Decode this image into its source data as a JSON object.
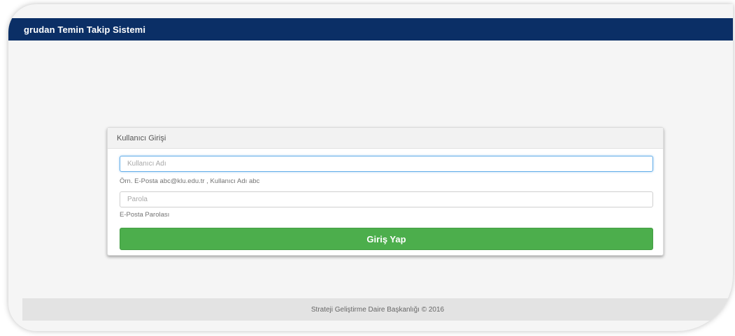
{
  "navbar": {
    "brand": "grudan Temin Takip Sistemi"
  },
  "login": {
    "heading": "Kullanıcı Girişi",
    "username_placeholder": "Kullanıcı Adı",
    "username_help": "Örn. E-Posta abc@klu.edu.tr , Kullanıcı Adı abc",
    "password_placeholder": "Parola",
    "password_help": "E-Posta Parolası",
    "submit_label": "Giriş Yap"
  },
  "footer": {
    "text": "Strateji Geliştirme Daire Başkanlığı © 2016"
  },
  "colors": {
    "navbar": "#0b2f66",
    "button": "#4cae4c",
    "background": "#f5f5f5"
  }
}
